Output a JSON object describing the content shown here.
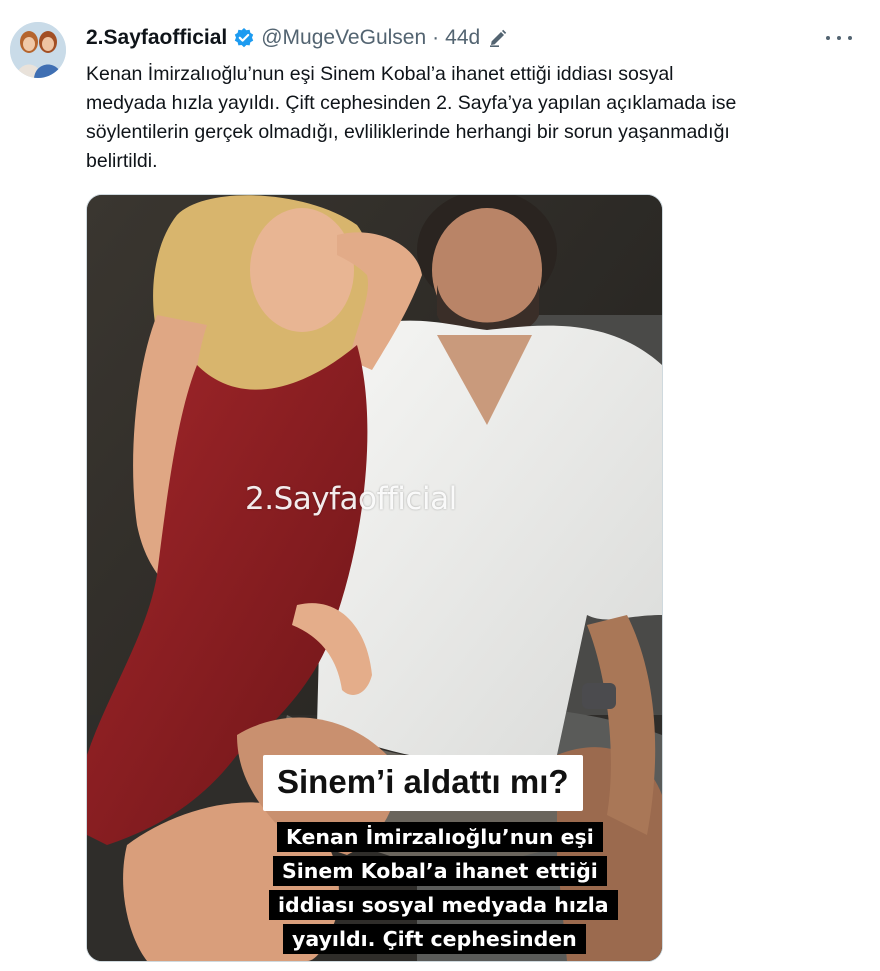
{
  "tweet": {
    "display_name": "2.Sayfaofficial",
    "handle": "@MugeVeGulsen",
    "separator": "·",
    "time": "44d",
    "text_lines": [
      "Kenan İmirzalıoğlu’nun eşi Sinem Kobal’a ihanet ettiği iddiası sosyal",
      "medyada hızla yayıldı. Çift cephesinden 2. Sayfa’ya yapılan açıklamada ise",
      "söylentilerin gerçek olmadığı, evliliklerinde herhangi bir sorun yaşanmadığı",
      "belirtildi."
    ]
  },
  "media": {
    "watermark": "2.Sayfaofficial",
    "headline": "Sinem’i aldattı mı?",
    "caption_lines": [
      "Kenan İmirzalıoğlu’nun eşi",
      "Sinem Kobal’a ihanet ettiği",
      "iddiası sosyal medyada hızla",
      "yayıldı. Çift cephesinden"
    ]
  },
  "icons": {
    "verified": "verified-badge-icon",
    "edit": "edit-pencil-icon",
    "more": "more-options-icon"
  },
  "colors": {
    "verified_blue": "#1d9bf0",
    "secondary_text": "#536471",
    "primary_text": "#0f1419"
  }
}
